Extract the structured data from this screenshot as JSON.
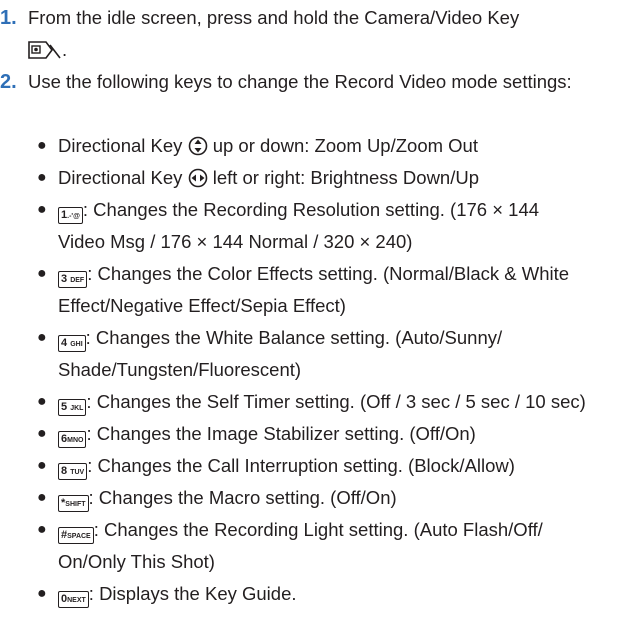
{
  "steps": [
    {
      "number": "1.",
      "text_a": "From the idle screen, press and hold the Camera/Video Key",
      "text_b": "."
    },
    {
      "number": "2.",
      "text": "Use the following keys to change the Record Video mode settings:"
    }
  ],
  "bullets": [
    {
      "icon": "nav-up-down-icon",
      "pre": "Directional Key",
      "post": "up or down: Zoom Up/Zoom Out"
    },
    {
      "icon": "nav-left-right-icon",
      "pre": "Directional Key",
      "post": "left or right: Brightness Down/Up"
    },
    {
      "key_main": "1",
      "key_sub": ".-'@",
      "text": ": Changes the Recording Resolution setting. (176 × 144 Video Msg / 176 × 144 Normal / 320 × 240)"
    },
    {
      "key_main": "3",
      "key_sub": "DEF",
      "text": ": Changes the Color Effects setting. (Normal/Black & White Effect/Negative Effect/Sepia Effect)"
    },
    {
      "key_main": "4",
      "key_sub": "GHI",
      "text": ": Changes the White Balance setting. (Auto/Sunny/ Shade/Tungsten/Fluorescent)"
    },
    {
      "key_main": "5",
      "key_sub": "JKL",
      "text": ": Changes the Self Timer setting. (Off / 3 sec / 5 sec / 10 sec)"
    },
    {
      "key_main": "6",
      "key_sub": "MNO",
      "text": ": Changes the Image Stabilizer setting. (Off/On)"
    },
    {
      "key_main": "8",
      "key_sub": "TUV",
      "text": ": Changes the Call Interruption setting. (Block/Allow)"
    },
    {
      "key_main": "*",
      "key_sub": "SHIFT",
      "text": ": Changes the Macro setting. (Off/On)"
    },
    {
      "key_main": "#",
      "key_sub": "SPACE",
      "text": ": Changes the Recording Light setting. (Auto Flash/Off/ On/Only This Shot)"
    },
    {
      "key_main": "0",
      "key_sub": "NEXT",
      "text": ": Displays the Key Guide."
    }
  ],
  "colors": {
    "step_number": "#2e6fb7",
    "text": "#231f20"
  }
}
